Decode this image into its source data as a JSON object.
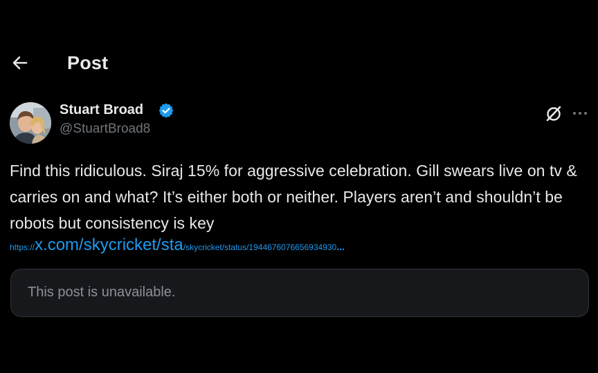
{
  "header": {
    "title": "Post",
    "back_icon": "arrow-left-icon"
  },
  "author": {
    "display_name": "Stuart Broad",
    "handle": "@StuartBroad8",
    "verified": true,
    "verified_color": "#1d9bf0"
  },
  "post": {
    "text": "Find this ridiculous. Siraj 15% for aggressive celebration. Gill swears live on tv & carries on and what? It’s either both or neither. Players aren’t and shouldn’t be robots but consistency is key",
    "link": {
      "prefix": "https://",
      "main": "x.com/skycricket/sta",
      "path": "/skycricket/status/1944676076656934930",
      "ellipsis": "..."
    }
  },
  "quoted": {
    "unavailable_text": "This post is unavailable."
  },
  "icons": {
    "grok": "grok-icon",
    "more": "more-options-icon"
  },
  "colors": {
    "background": "#000000",
    "text": "#e7e9ea",
    "secondary_text": "#71767b",
    "link": "#1d9bf0",
    "card_bg": "#16181c"
  }
}
